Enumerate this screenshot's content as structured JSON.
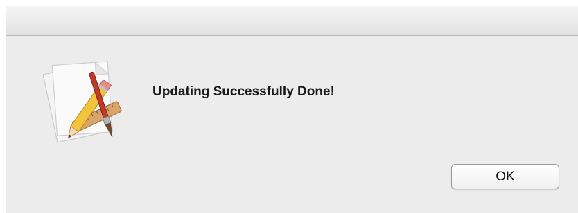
{
  "dialog": {
    "message": "Updating Successfully Done!",
    "icon": "text-edit-app-icon",
    "ok_label": "OK"
  },
  "colors": {
    "dialog_background": "#ececec",
    "titlebar_top": "#f6f6f6",
    "titlebar_bottom": "#e1e1e1"
  }
}
